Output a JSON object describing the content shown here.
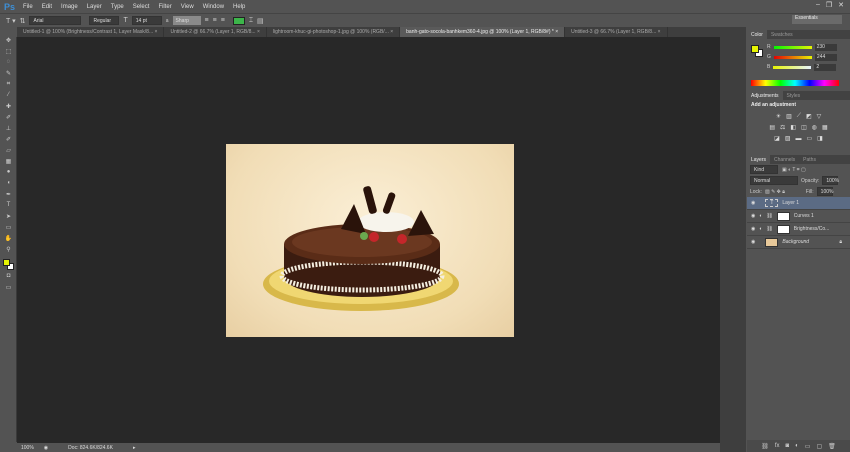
{
  "app": {
    "logo": "Ps"
  },
  "menu": [
    "File",
    "Edit",
    "Image",
    "Layer",
    "Type",
    "Select",
    "Filter",
    "View",
    "Window",
    "Help"
  ],
  "window_controls": [
    "–",
    "❐",
    "✕"
  ],
  "options": {
    "font_family": "Arial",
    "font_style": "Regular",
    "font_size": "14 pt",
    "aa_label": "a",
    "antialias": "Sharp",
    "text_color": "#3cb54a",
    "workspace": "Essentials"
  },
  "tabs": [
    {
      "label": "Untitled-1 @ 100% (Brightness/Contrast 1, Layer Mask/8... ×",
      "active": false
    },
    {
      "label": "Untitled-2 @ 66.7% (Layer 1, RGB/8... ×",
      "active": false
    },
    {
      "label": "lightroom-khuc-gi-photoshop-1.jpg @ 100% (RGB/... ×",
      "active": false
    },
    {
      "label": "banh-gato-socola-banhkem360-4.jpg @ 100% (Layer 1, RGB/8#) * ×",
      "active": true
    },
    {
      "label": "Untitled-3 @ 66.7% (Layer 1, RGB/8... ×",
      "active": false
    }
  ],
  "status": {
    "zoom": "100%",
    "doc": "Doc: 824.6K/824.6K"
  },
  "color_panel": {
    "tabs": [
      "Color",
      "Swatches"
    ],
    "fg": "#e6f402",
    "channels": [
      {
        "label": "R",
        "value": "230"
      },
      {
        "label": "G",
        "value": "244"
      },
      {
        "label": "B",
        "value": "2"
      }
    ]
  },
  "adjustments_panel": {
    "tabs": [
      "Adjustments",
      "Styles"
    ],
    "title": "Add an adjustment"
  },
  "layers_panel": {
    "tabs": [
      "Layers",
      "Channels",
      "Paths"
    ],
    "filter": "Kind",
    "blend_mode": "Normal",
    "opacity_label": "Opacity:",
    "opacity": "100%",
    "lock_label": "Lock:",
    "fill_label": "Fill:",
    "fill": "100%",
    "layers": [
      {
        "name": "Layer 1",
        "type": "text",
        "selected": true
      },
      {
        "name": "Curves 1",
        "type": "adjustment"
      },
      {
        "name": "Brightness/Co...",
        "type": "adjustment"
      },
      {
        "name": "Background",
        "type": "image",
        "locked": true
      }
    ]
  }
}
